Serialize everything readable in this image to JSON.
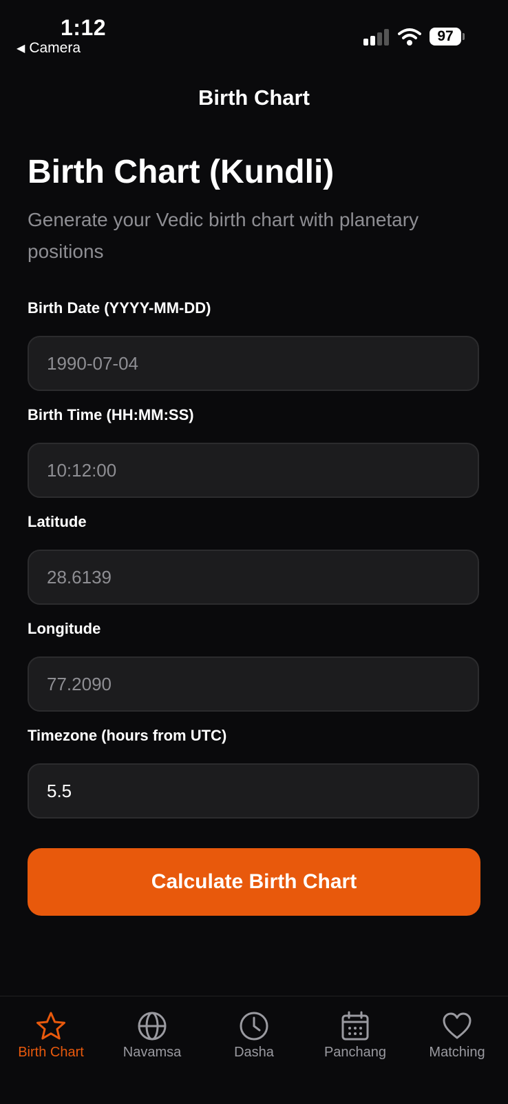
{
  "status_bar": {
    "time": "1:12",
    "back_label": "Camera",
    "battery": "97"
  },
  "nav": {
    "title": "Birth Chart"
  },
  "page": {
    "heading": "Birth Chart (Kundli)",
    "subtitle": "Generate your Vedic birth chart with planetary positions"
  },
  "form": {
    "birth_date": {
      "label": "Birth Date (YYYY-MM-DD)",
      "placeholder": "1990-07-04",
      "value": ""
    },
    "birth_time": {
      "label": "Birth Time (HH:MM:SS)",
      "placeholder": "10:12:00",
      "value": ""
    },
    "latitude": {
      "label": "Latitude",
      "placeholder": "28.6139",
      "value": ""
    },
    "longitude": {
      "label": "Longitude",
      "placeholder": "77.2090",
      "value": ""
    },
    "timezone": {
      "label": "Timezone (hours from UTC)",
      "placeholder": "",
      "value": "5.5"
    },
    "submit_label": "Calculate Birth Chart"
  },
  "tabbar": {
    "active": "Birth Chart",
    "items": [
      {
        "label": "Birth Chart",
        "icon": "star-icon"
      },
      {
        "label": "Navamsa",
        "icon": "globe-icon"
      },
      {
        "label": "Dasha",
        "icon": "clock-icon"
      },
      {
        "label": "Panchang",
        "icon": "calendar-icon"
      },
      {
        "label": "Matching",
        "icon": "heart-icon"
      }
    ]
  },
  "colors": {
    "accent": "#e8590c",
    "background": "#0a0a0c",
    "field_bg": "#1c1c1e",
    "muted_text": "#8e8e93"
  }
}
